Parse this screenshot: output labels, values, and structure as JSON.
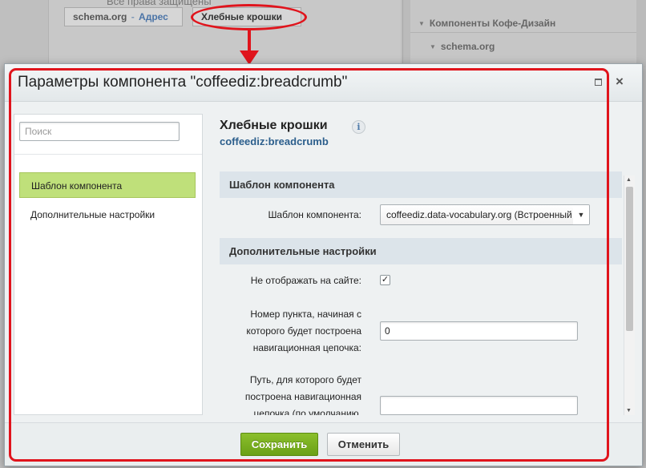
{
  "background": {
    "copyright": "Все права защищены",
    "breadcrumb_1": {
      "part1": "schema.org",
      "sep": "-",
      "part2": "Адрес"
    },
    "breadcrumb_2": "Хлебные крошки",
    "right_panel": {
      "item1": "Компоненты Кофе-Дизайн",
      "item2": "schema.org"
    }
  },
  "annotation": {
    "color": "#e0141c"
  },
  "dialog": {
    "title": "Параметры компонента \"coffeediz:breadcrumb\"",
    "search_placeholder": "Поиск",
    "sidebar": {
      "items": [
        {
          "label": "Шаблон компонента",
          "active": true
        },
        {
          "label": "Дополнительные настройки",
          "active": false
        }
      ]
    },
    "component": {
      "name": "Хлебные крошки",
      "code": "coffeediz:breadcrumb",
      "info_icon": "i"
    },
    "sections": [
      {
        "title": "Шаблон компонента"
      },
      {
        "title": "Дополнительные настройки"
      }
    ],
    "fields": {
      "template_label": "Шаблон компонента:",
      "template_value": "coffeediz.data-vocabulary.org (Встроенный шаблон)",
      "hide_label": "Не отображать на сайте:",
      "hide_checked": true,
      "start_label_1": "Номер пункта, начиная с",
      "start_label_2": "которого будет построена",
      "start_label_3": "навигационная цепочка:",
      "start_value": "0",
      "path_label_1": "Путь, для которого будет",
      "path_label_2": "построена навигационная",
      "path_label_3": "цепочка (по умолчанию,",
      "path_value": ""
    },
    "buttons": {
      "save": "Сохранить",
      "cancel": "Отменить"
    },
    "accent_color": "#6aa016",
    "active_item_color": "#bfe07a"
  }
}
